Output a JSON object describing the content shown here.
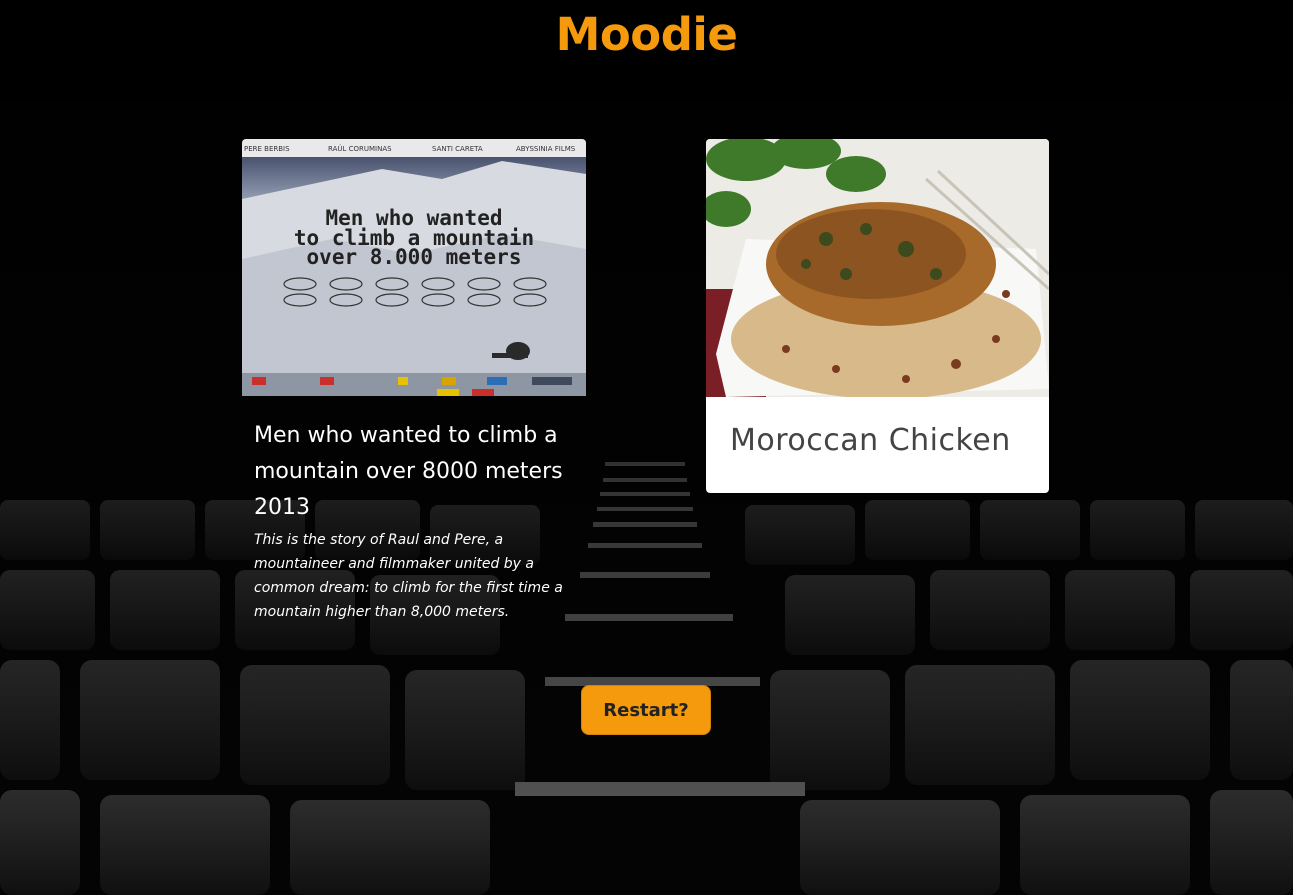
{
  "app": {
    "title": "Moodie"
  },
  "movie": {
    "poster_text_line1": "Men who wanted",
    "poster_text_line2": "to climb a mountain",
    "poster_text_line3": "over 8.000 meters",
    "poster_credits": [
      "PERE BERBIS",
      "RAÚL CORUMINAS",
      "SANTI CARETA",
      "ABYSSINIA FILMS"
    ],
    "title": "Men who wanted to climb a mountain over 8000 meters 2013",
    "description": "This is the story of Raul and Pere, a mountaineer and filmmaker united by a common dream: to climb for the first time a mountain higher than 8,000 meters."
  },
  "recipe": {
    "title": "Moroccan Chicken"
  },
  "actions": {
    "restart_label": "Restart?"
  },
  "colors": {
    "accent": "#f59a0c",
    "background": "#000000",
    "card": "#ffffff"
  }
}
